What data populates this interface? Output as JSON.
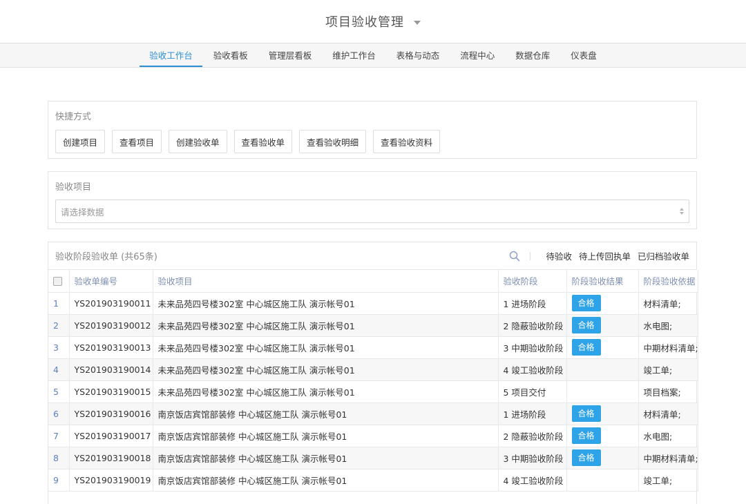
{
  "app": {
    "title": "项目验收管理"
  },
  "nav": {
    "tabs": [
      {
        "label": "验收工作台",
        "active": true
      },
      {
        "label": "验收看板"
      },
      {
        "label": "管理层看板"
      },
      {
        "label": "维护工作台"
      },
      {
        "label": "表格与动态"
      },
      {
        "label": "流程中心"
      },
      {
        "label": "数据仓库"
      },
      {
        "label": "仪表盘"
      }
    ]
  },
  "shortcuts": {
    "title": "快捷方式",
    "buttons": [
      "创建项目",
      "查看项目",
      "创建验收单",
      "查看验收单",
      "查看验收明细",
      "查看验收资料"
    ]
  },
  "project_select": {
    "title": "验收项目",
    "placeholder": "请选择数据"
  },
  "table": {
    "title": "验收阶段验收单 (共65条)",
    "search_icon": "search-icon",
    "filters": [
      "待验收",
      "待上传回执单",
      "已归档验收单"
    ],
    "columns": [
      "验收单编号",
      "验收项目",
      "验收阶段",
      "阶段验收结果",
      "阶段验收依据"
    ],
    "rows": [
      {
        "idx": "1",
        "code": "YS201903190011",
        "project": "未来品苑四号楼302室 中心城区施工队 演示帐号01",
        "stage": "1 进场阶段",
        "result": "合格",
        "basis": "材料清单;"
      },
      {
        "idx": "2",
        "code": "YS201903190012",
        "project": "未来品苑四号楼302室 中心城区施工队 演示帐号01",
        "stage": "2 隐蔽验收阶段",
        "result": "合格",
        "basis": "水电图;"
      },
      {
        "idx": "3",
        "code": "YS201903190013",
        "project": "未来品苑四号楼302室 中心城区施工队 演示帐号01",
        "stage": "3 中期验收阶段",
        "result": "合格",
        "basis": "中期材料清单;"
      },
      {
        "idx": "4",
        "code": "YS201903190014",
        "project": "未来品苑四号楼302室 中心城区施工队 演示帐号01",
        "stage": "4 竣工验收阶段",
        "result": "",
        "basis": "竣工单;"
      },
      {
        "idx": "5",
        "code": "YS201903190015",
        "project": "未来品苑四号楼302室 中心城区施工队 演示帐号01",
        "stage": "5 项目交付",
        "result": "",
        "basis": "项目档案;"
      },
      {
        "idx": "6",
        "code": "YS201903190016",
        "project": "南京饭店宾馆部装修 中心城区施工队 演示帐号01",
        "stage": "1 进场阶段",
        "result": "合格",
        "basis": "材料清单;"
      },
      {
        "idx": "7",
        "code": "YS201903190017",
        "project": "南京饭店宾馆部装修 中心城区施工队 演示帐号01",
        "stage": "2 隐蔽验收阶段",
        "result": "合格",
        "basis": "水电图;"
      },
      {
        "idx": "8",
        "code": "YS201903190018",
        "project": "南京饭店宾馆部装修 中心城区施工队 演示帐号01",
        "stage": "3 中期验收阶段",
        "result": "合格",
        "basis": "中期材料清单;"
      },
      {
        "idx": "9",
        "code": "YS201903190019",
        "project": "南京饭店宾馆部装修 中心城区施工队 演示帐号01",
        "stage": "4 竣工验收阶段",
        "result": "",
        "basis": "竣工单;"
      }
    ]
  },
  "colors": {
    "accent": "#2a8fd6",
    "badge": "#2ea3e8"
  }
}
